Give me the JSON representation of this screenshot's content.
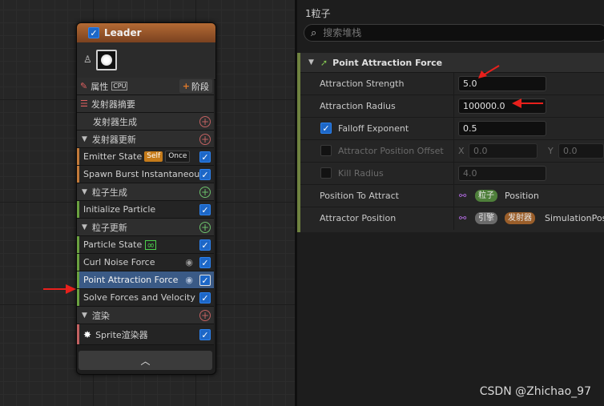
{
  "node": {
    "title": "Leader",
    "rows": [
      {
        "kind": "section",
        "icon": "pencil-icon",
        "label": "属性",
        "badge": "CPU",
        "button": "阶段"
      },
      {
        "kind": "section",
        "icon": "list-icon",
        "label": "发射器摘要"
      },
      {
        "kind": "section",
        "label": "发射器生成",
        "plus": "red"
      },
      {
        "kind": "section",
        "label": "发射器更新",
        "plus": "red"
      },
      {
        "kind": "item",
        "label": "Emitter State",
        "badges": [
          "Self",
          "Once"
        ]
      },
      {
        "kind": "item",
        "label": "Spawn Burst Instantaneous"
      },
      {
        "kind": "section",
        "label": "粒子生成",
        "plus": "green"
      },
      {
        "kind": "item",
        "label": "Initialize Particle"
      },
      {
        "kind": "section",
        "label": "粒子更新",
        "plus": "green"
      },
      {
        "kind": "item",
        "label": "Particle State"
      },
      {
        "kind": "item",
        "label": "Curl Noise Force"
      },
      {
        "kind": "item",
        "label": "Point Attraction Force"
      },
      {
        "kind": "item",
        "label": "Solve Forces and Velocity"
      },
      {
        "kind": "section",
        "label": "渲染",
        "plus": "red"
      },
      {
        "kind": "item",
        "label": "Sprite渲染器"
      }
    ]
  },
  "panel": {
    "title": "1粒子",
    "search_placeholder": "搜索堆栈",
    "module_title": "Point Attraction Force",
    "props": {
      "attraction_strength": {
        "label": "Attraction Strength",
        "value": "5.0"
      },
      "attraction_radius": {
        "label": "Attraction Radius",
        "value": "100000.0"
      },
      "falloff_exponent": {
        "label": "Falloff Exponent",
        "value": "0.5"
      },
      "attractor_position_offset": {
        "label": "Attractor Position Offset",
        "x_label": "X",
        "x": "0.0",
        "y_label": "Y",
        "y": "0.0"
      },
      "kill_radius": {
        "label": "Kill Radius",
        "value": "4.0"
      },
      "position_to_attract": {
        "label": "Position To Attract",
        "tag": "粒子",
        "text": "Position"
      },
      "attractor_position": {
        "label": "Attractor Position",
        "tag1": "引擎",
        "tag2": "发射器",
        "text": "SimulationPosit"
      }
    }
  },
  "watermark": "CSDN @Zhichao_97",
  "colors": {
    "node_header": "#b46a34",
    "selected_row": "#3a5a86",
    "checkbox": "#1d67c7",
    "module_bar": "#6f8240",
    "arrow": "#e8201c"
  }
}
